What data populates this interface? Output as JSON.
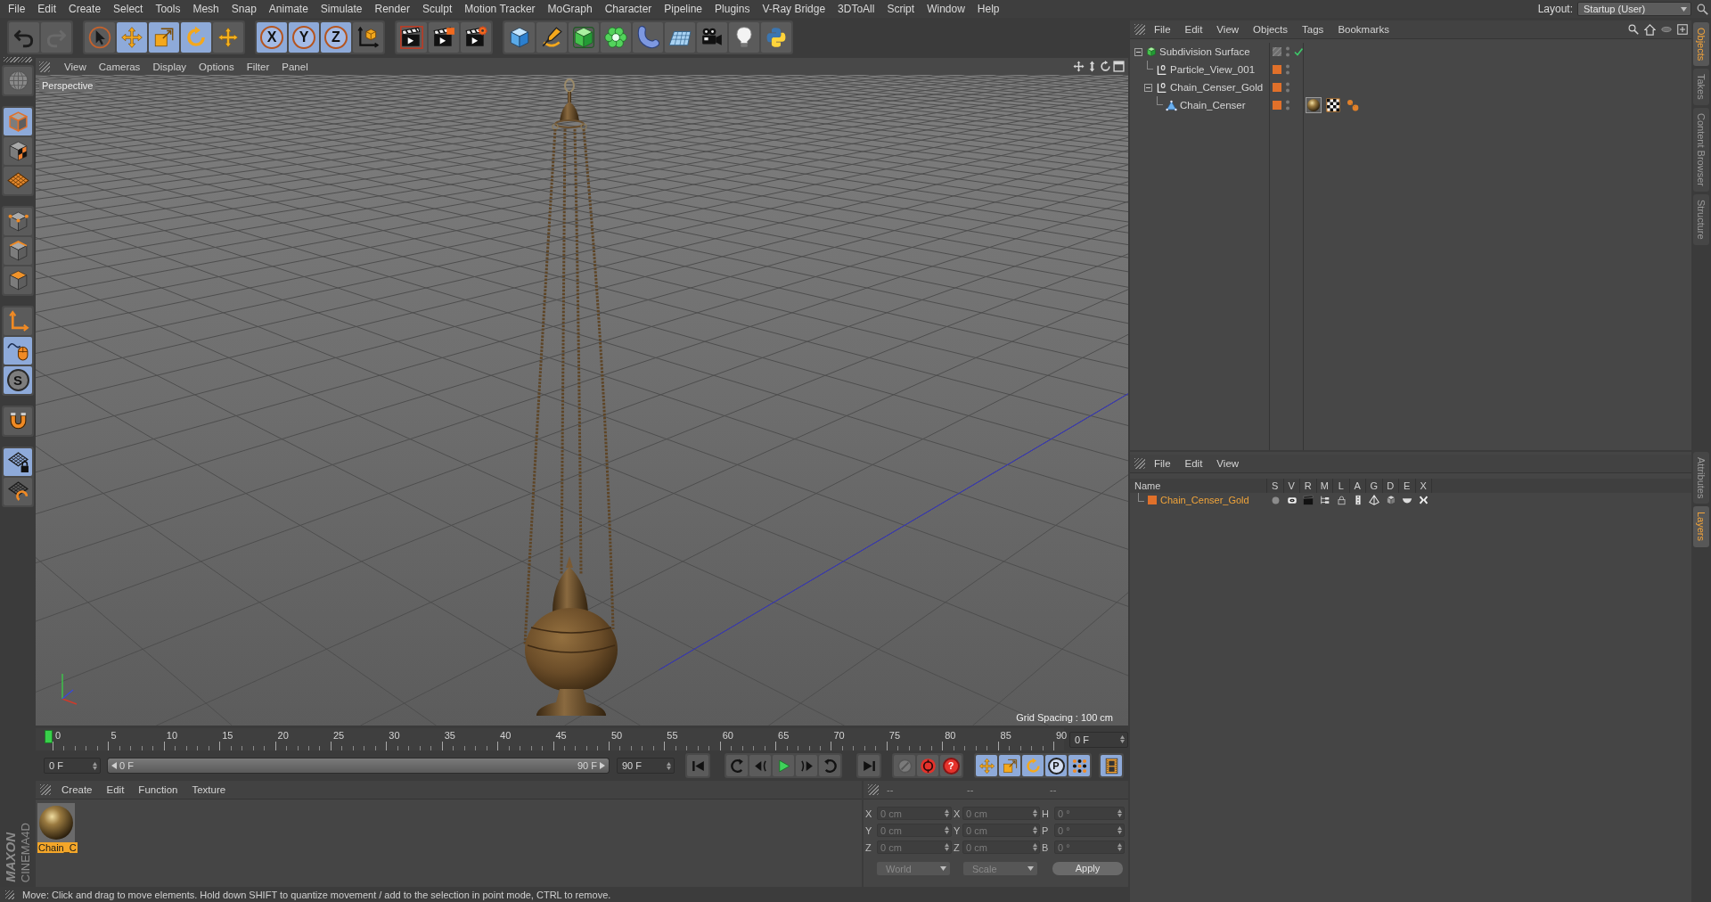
{
  "menu_bar": {
    "items": [
      "File",
      "Edit",
      "Create",
      "Select",
      "Tools",
      "Mesh",
      "Snap",
      "Animate",
      "Simulate",
      "Render",
      "Sculpt",
      "Motion Tracker",
      "MoGraph",
      "Character",
      "Pipeline",
      "Plugins",
      "V-Ray Bridge",
      "3DToAll",
      "Script",
      "Window",
      "Help"
    ],
    "layout_label": "Layout:",
    "layout_value": "Startup (User)"
  },
  "toolbar": {
    "groups": [
      {
        "buttons": [
          {
            "kind": "undo",
            "active": false,
            "disabled": false
          },
          {
            "kind": "redo",
            "active": false,
            "disabled": true
          }
        ]
      },
      {
        "buttons": [
          {
            "kind": "select",
            "active": false
          },
          {
            "kind": "move",
            "active": true
          },
          {
            "kind": "scale",
            "active": true
          },
          {
            "kind": "rotate",
            "active": true
          },
          {
            "kind": "recent",
            "active": false
          }
        ]
      },
      {
        "buttons": [
          {
            "kind": "axis-lock",
            "label": "X",
            "active": true
          },
          {
            "kind": "axis-lock",
            "label": "Y",
            "active": true
          },
          {
            "kind": "axis-lock",
            "label": "Z",
            "active": true
          },
          {
            "kind": "coordinates",
            "active": false
          }
        ]
      },
      {
        "buttons": [
          {
            "kind": "render-view",
            "active": false
          },
          {
            "kind": "render",
            "active": false
          },
          {
            "kind": "render-settings",
            "active": false
          }
        ]
      },
      {
        "buttons": [
          {
            "kind": "cube",
            "active": false
          },
          {
            "kind": "pen",
            "active": false
          },
          {
            "kind": "subdivision",
            "active": false
          },
          {
            "kind": "cloner",
            "active": false
          },
          {
            "kind": "deformer",
            "active": false
          },
          {
            "kind": "floor",
            "active": false
          },
          {
            "kind": "camera",
            "active": false
          },
          {
            "kind": "light",
            "active": false
          },
          {
            "kind": "python",
            "active": false
          }
        ]
      }
    ]
  },
  "left_toolbar": {
    "groups": [
      {
        "buttons": [
          {
            "kind": "make-editable",
            "active": false
          }
        ]
      },
      {
        "buttons": [
          {
            "kind": "model",
            "active": true
          },
          {
            "kind": "texture",
            "active": false
          },
          {
            "kind": "workplane",
            "active": false
          }
        ]
      },
      {
        "buttons": [
          {
            "kind": "points",
            "active": false
          },
          {
            "kind": "edges",
            "active": false
          },
          {
            "kind": "polygons",
            "active": false
          }
        ]
      },
      {
        "buttons": [
          {
            "kind": "axis",
            "active": false
          },
          {
            "kind": "tweak",
            "active": true
          },
          {
            "kind": "solo",
            "label": "S",
            "active": true
          }
        ]
      },
      {
        "buttons": [
          {
            "kind": "snap",
            "active": false
          }
        ]
      },
      {
        "buttons": [
          {
            "kind": "workplane-lock",
            "active": true
          },
          {
            "kind": "workplane-align",
            "active": false
          }
        ]
      }
    ]
  },
  "logo": {
    "brand": "MAXON",
    "product": "CINEMA4D"
  },
  "viewport": {
    "menu": [
      "View",
      "Cameras",
      "Display",
      "Options",
      "Filter",
      "Panel"
    ],
    "camera_name": "Perspective",
    "grid_spacing": "Grid Spacing : 100 cm"
  },
  "timeline": {
    "ticks": [
      "0",
      "5",
      "10",
      "15",
      "20",
      "25",
      "30",
      "35",
      "40",
      "45",
      "50",
      "55",
      "60",
      "65",
      "70",
      "75",
      "80",
      "85",
      "90"
    ],
    "playhead": {
      "level": 0
    },
    "current_frame": "0 F"
  },
  "transport": {
    "start_frame": "0 F",
    "range": {
      "start": "0 F",
      "end": "90 F",
      "level": 1
    },
    "end_frame": "90 F",
    "groups": [
      {
        "buttons": [
          {
            "kind": "go-start",
            "active": false
          }
        ]
      },
      {
        "buttons": [
          {
            "kind": "prev-key",
            "active": false
          },
          {
            "kind": "step-back",
            "active": false
          },
          {
            "kind": "play",
            "active": false
          },
          {
            "kind": "step-forward",
            "active": false
          },
          {
            "kind": "next-key",
            "active": false
          }
        ]
      },
      {
        "buttons": [
          {
            "kind": "go-end",
            "active": false
          }
        ]
      },
      {
        "buttons": [
          {
            "kind": "record-keys",
            "active": false
          },
          {
            "kind": "record",
            "active": false
          },
          {
            "kind": "autokey",
            "label": "?",
            "active": false
          }
        ]
      },
      {
        "buttons": [
          {
            "kind": "key-move",
            "active": true
          },
          {
            "kind": "key-scale",
            "active": true
          },
          {
            "kind": "key-rotate",
            "active": true
          },
          {
            "kind": "key-param",
            "label": "P",
            "active": true
          },
          {
            "kind": "key-points",
            "active": true
          }
        ]
      },
      {
        "buttons": [
          {
            "kind": "timeline",
            "active": true
          }
        ]
      }
    ]
  },
  "materials": {
    "menu": [
      "Create",
      "Edit",
      "Function",
      "Texture"
    ],
    "items": [
      {
        "name": "Chain_C",
        "selected": true
      }
    ]
  },
  "coordinates": {
    "headers": [
      "--",
      "--",
      "--"
    ],
    "disabled": true,
    "rows": [
      {
        "position_axis": "X",
        "position": "0 cm",
        "size_axis": "X",
        "size": "0 cm",
        "rotation_axis": "H",
        "rotation": "0 °"
      },
      {
        "position_axis": "Y",
        "position": "0 cm",
        "size_axis": "Y",
        "size": "0 cm",
        "rotation_axis": "P",
        "rotation": "0 °"
      },
      {
        "position_axis": "Z",
        "position": "0 cm",
        "size_axis": "Z",
        "size": "0 cm",
        "rotation_axis": "B",
        "rotation": "0 °"
      }
    ],
    "position_mode": "World",
    "size_mode": "Scale",
    "apply": "Apply"
  },
  "status_bar": {
    "text": "Move: Click and drag to move elements. Hold down SHIFT to quantize movement / add to the selection in point mode, CTRL to remove."
  },
  "objects": {
    "menu": [
      "File",
      "Edit",
      "View",
      "Objects",
      "Tags",
      "Bookmarks"
    ],
    "tree": [
      {
        "name": "Subdivision Surface",
        "kind": "subdivision",
        "expanded": true,
        "enabled": true,
        "children": [
          {
            "name": "Particle_View_001",
            "kind": "null",
            "color": "#e0702a"
          },
          {
            "name": "Chain_Censer_Gold",
            "kind": "null",
            "color": "#e0702a",
            "expanded": true,
            "children": [
              {
                "name": "Chain_Censer",
                "kind": "polygon",
                "color": "#e0702a",
                "tags": [
                  {
                    "kind": "material",
                    "selected": true
                  },
                  {
                    "kind": "texture",
                    "selected": false
                  },
                  {
                    "kind": "dots",
                    "selected": false
                  }
                ]
              }
            ]
          }
        ]
      }
    ]
  },
  "layers": {
    "menu": [
      "File",
      "Edit",
      "View"
    ],
    "columns": [
      "Name",
      "S",
      "V",
      "R",
      "M",
      "L",
      "A",
      "G",
      "D",
      "E",
      "X"
    ],
    "rows": [
      {
        "name": "Chain_Censer_Gold",
        "color": "#e0702a",
        "selected": true
      }
    ]
  },
  "side_tabs": {
    "top": [
      {
        "label": "Objects",
        "selected": true
      },
      {
        "label": "Takes",
        "selected": false
      },
      {
        "label": "Content Browser",
        "selected": false
      },
      {
        "label": "Structure",
        "selected": false
      }
    ],
    "bottom": [
      {
        "label": "Attributes",
        "selected": false
      },
      {
        "label": "Layers",
        "selected": true
      }
    ]
  }
}
